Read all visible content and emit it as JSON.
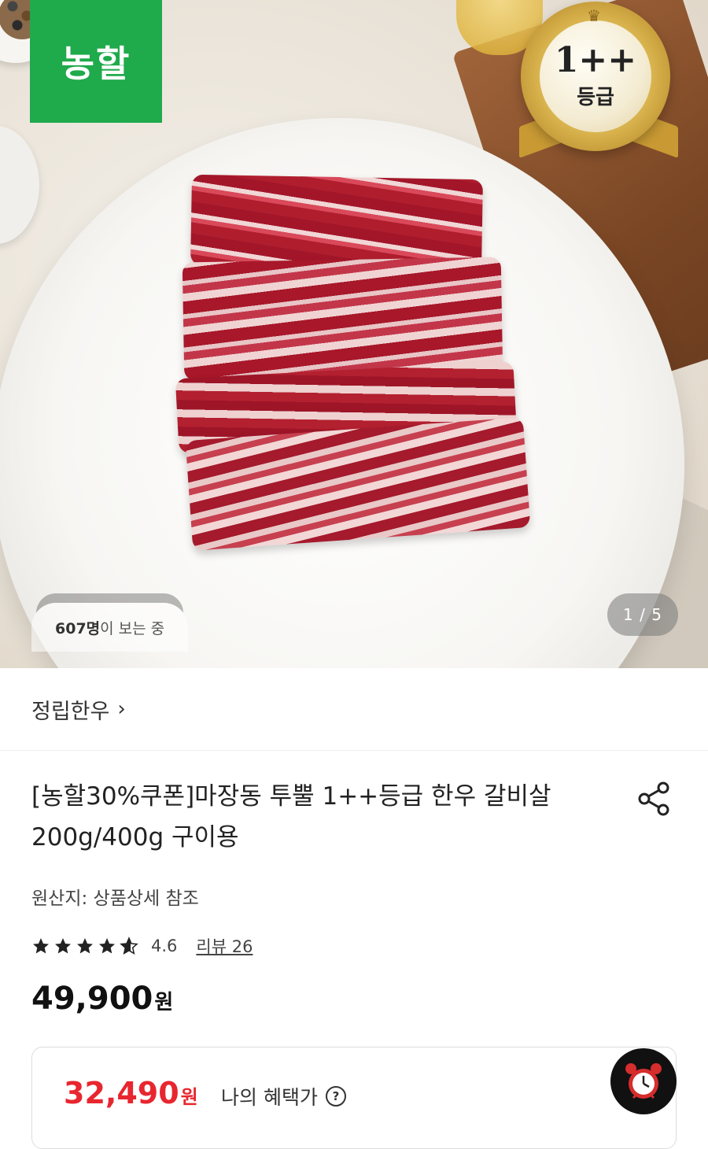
{
  "hero": {
    "brand_logo": "농할",
    "grade_badge": {
      "grade": "1++",
      "label": "등급"
    },
    "viewers": {
      "count": "607명",
      "suffix": "이 보는 중"
    },
    "image_counter": "1 / 5"
  },
  "store": {
    "name": "정립한우",
    "chevron": "›"
  },
  "product": {
    "title": "[농할30%쿠폰]마장동 투뿔 1++등급 한우 갈비살 200g/400g 구이용",
    "origin": "원산지: 상품상세 참조",
    "rating": {
      "score": "4.6",
      "stars": 4.6,
      "review_label": "리뷰 26"
    },
    "price": {
      "amount": "49,900",
      "unit": "원"
    }
  },
  "benefit": {
    "price": {
      "amount": "32,490",
      "unit": "원"
    },
    "label": "나의 혜택가",
    "help": "?"
  },
  "icons": {
    "share": "share-icon",
    "clock": "alarm-clock-icon",
    "help": "help-icon",
    "star": "star-icon"
  },
  "colors": {
    "brand_green": "#1faa4b",
    "sale_red": "#e8262f",
    "text": "#222222"
  }
}
